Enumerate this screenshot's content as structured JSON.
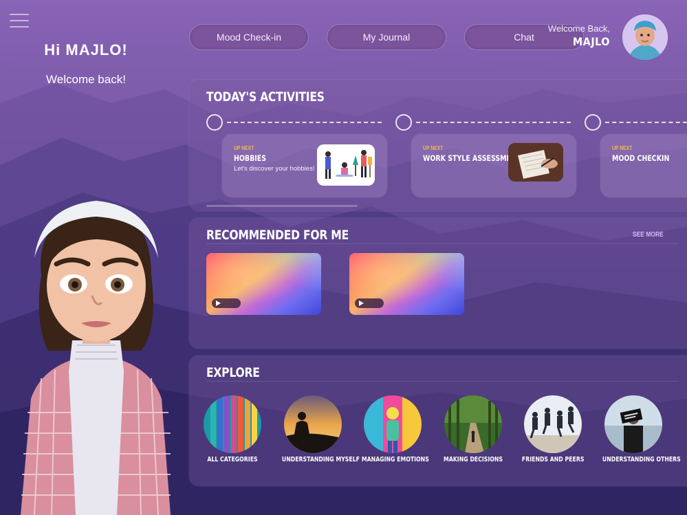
{
  "greeting": {
    "title": "Hi MAJLO!",
    "subtitle": "Welcome back!"
  },
  "nav": {
    "mood_checkin": "Mood Check-in",
    "journal": "My Journal",
    "chat": "Chat"
  },
  "user": {
    "welcome": "Welcome Back,",
    "name": "MAJLO"
  },
  "activities": {
    "title": "TODAY'S ACTIVITIES",
    "items": [
      {
        "tag": "UP NEXT",
        "name": "HOBBIES",
        "desc": "Let's discover your hobbies!"
      },
      {
        "tag": "UP NEXT",
        "name": "WORK STYLE ASSESSMENT",
        "desc": ""
      },
      {
        "tag": "UP NEXT",
        "name": "MOOD CHECKIN",
        "desc": ""
      }
    ]
  },
  "recommended": {
    "title": "RECOMMENDED FOR ME",
    "see_more": "SEE MORE"
  },
  "explore": {
    "title": "EXPLORE",
    "categories": [
      {
        "label": "ALL CATEGORIES"
      },
      {
        "label": "UNDERSTANDING MYSELF"
      },
      {
        "label": "MANAGING EMOTIONS"
      },
      {
        "label": "MAKING DECISIONS"
      },
      {
        "label": "FRIENDS AND PEERS"
      },
      {
        "label": "UNDERSTANDING OTHERS"
      }
    ]
  },
  "colors": {
    "accent_tag": "#f1b94a",
    "see_more": "#d7b9f2",
    "bg_top": "#8a64b6",
    "bg_bottom": "#2e2460"
  }
}
